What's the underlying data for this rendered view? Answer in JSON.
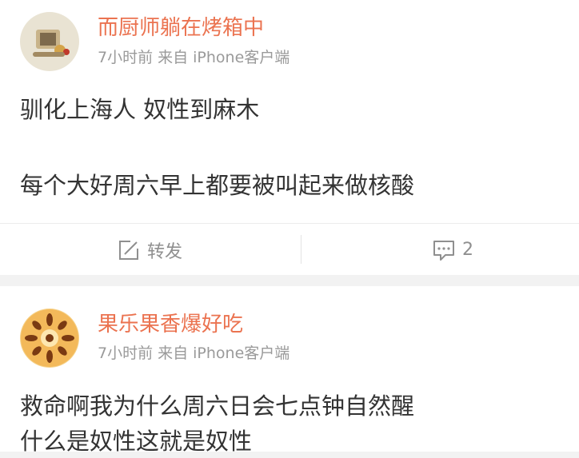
{
  "posts": [
    {
      "author": "而厨师躺在烤箱中",
      "time": "7小时前",
      "source": "来自 iPhone客户端",
      "lines": [
        "驯化上海人 奴性到麻木",
        "每个大好周六早上都要被叫起来做核酸"
      ],
      "repost_label": "转发",
      "comment_count": "2"
    },
    {
      "author": "果乐果香爆好吃",
      "time": "7小时前",
      "source": "来自 iPhone客户端",
      "lines": [
        "救命啊我为什么周六日会七点钟自然醒",
        "什么是奴性这就是奴性"
      ]
    }
  ],
  "colors": {
    "author": "#eb7350",
    "meta": "#9a9a9a",
    "text": "#333333",
    "action": "#8f8f8f"
  },
  "icons": {
    "repost": "compose-icon",
    "comment": "comment-icon"
  }
}
